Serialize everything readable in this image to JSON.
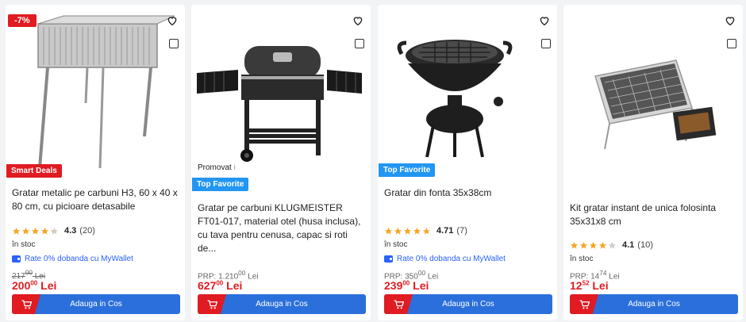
{
  "colors": {
    "brand_red": "#e01b22",
    "button_blue": "#2a6fdb",
    "badge_blue": "#2196f3",
    "star": "#f5a623"
  },
  "icons": {
    "favorite": "heart-icon",
    "compare": "checkbox-icon",
    "cart": "cart-icon",
    "wallet": "wallet-icon",
    "star": "star-icon"
  },
  "products": [
    {
      "discount": "-7%",
      "badge": "Smart Deals",
      "title": "Gratar metalic pe carbuni H3, 60 x 40 x 80 cm, cu picioare detasabile",
      "rating": 4.3,
      "rating_text": "4.3",
      "reviews": "(20)",
      "stock": "în stoc",
      "wallet": "Rate 0% dobanda cu MyWallet",
      "old_price": "217",
      "old_price_cents": "00",
      "old_price_suffix": " Lei",
      "price": "200",
      "price_cents": "00",
      "price_suffix": " Lei",
      "button": "Adauga in Cos"
    },
    {
      "promo": "Promovat",
      "promo_info": "i",
      "badge": "Top Favorite",
      "title": "Gratar pe carbuni KLUGMEISTER FT01-017, material otel (husa inclusa), cu tava pentru cenusa, capac si roti de...",
      "old_price_label": "PRP: ",
      "old_price": "1.210",
      "old_price_cents": "00",
      "old_price_suffix": " Lei",
      "price": "627",
      "price_cents": "00",
      "price_suffix": " Lei",
      "button": "Adauga in Cos"
    },
    {
      "badge": "Top Favorite",
      "title": "Gratar din fonta 35x38cm",
      "rating": 4.71,
      "rating_text": "4.71",
      "reviews": "(7)",
      "stock": "în stoc",
      "wallet": "Rate 0% dobanda cu MyWallet",
      "old_price_label": "PRP: ",
      "old_price": "350",
      "old_price_cents": "00",
      "old_price_suffix": " Lei",
      "price": "239",
      "price_cents": "00",
      "price_suffix": " Lei",
      "button": "Adauga in Cos"
    },
    {
      "title": "Kit gratar instant de unica folosinta 35x31x8 cm",
      "rating": 4.1,
      "rating_text": "4.1",
      "reviews": "(10)",
      "stock": "în stoc",
      "old_price_label": "PRP: ",
      "old_price": "14",
      "old_price_cents": "74",
      "old_price_suffix": " Lei",
      "price": "12",
      "price_cents": "52",
      "price_suffix": " Lei",
      "button": "Adauga in Cos"
    }
  ]
}
